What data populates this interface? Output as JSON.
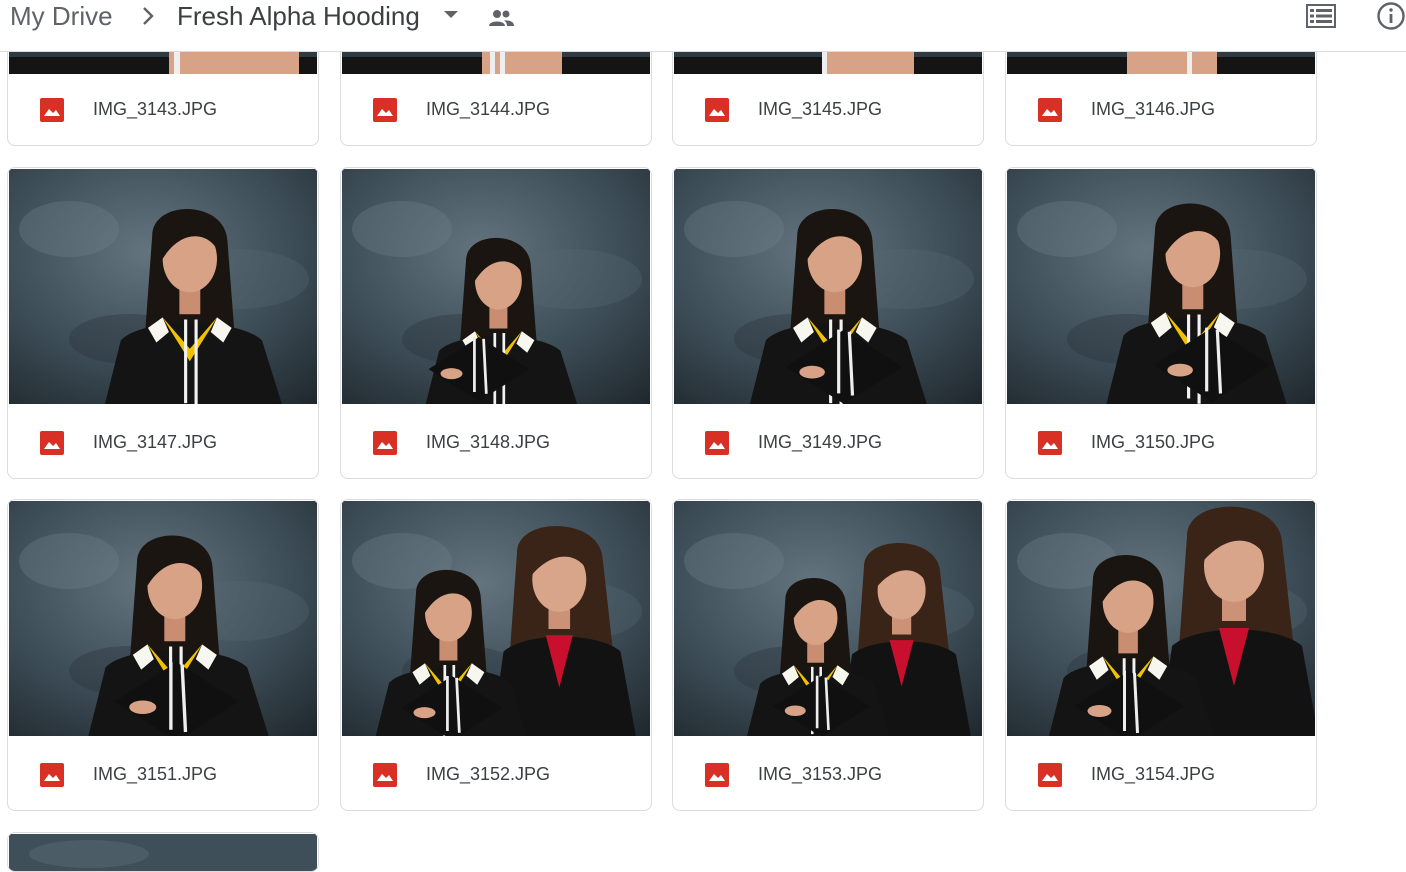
{
  "header": {
    "root_label": "My Drive",
    "folder_name": "Fresh Alpha Hooding",
    "icons": [
      "chevron-right-icon",
      "caret-down-icon",
      "shared-people-icon",
      "list-view-icon",
      "info-icon"
    ]
  },
  "files": [
    {
      "name": "IMG_3143.JPG"
    },
    {
      "name": "IMG_3144.JPG"
    },
    {
      "name": "IMG_3145.JPG"
    },
    {
      "name": "IMG_3146.JPG"
    },
    {
      "name": "IMG_3147.JPG"
    },
    {
      "name": "IMG_3148.JPG"
    },
    {
      "name": "IMG_3149.JPG"
    },
    {
      "name": "IMG_3150.JPG"
    },
    {
      "name": "IMG_3151.JPG"
    },
    {
      "name": "IMG_3152.JPG"
    },
    {
      "name": "IMG_3153.JPG"
    },
    {
      "name": "IMG_3154.JPG"
    }
  ],
  "colors": {
    "image_icon": "#d93025",
    "text": "#3c4043",
    "muted": "#5f6368",
    "border": "#dadce0",
    "backdrop": "#3a4a55",
    "gown": "#161616",
    "sash": "#f2c200",
    "blazer_top": "#c8102e"
  }
}
